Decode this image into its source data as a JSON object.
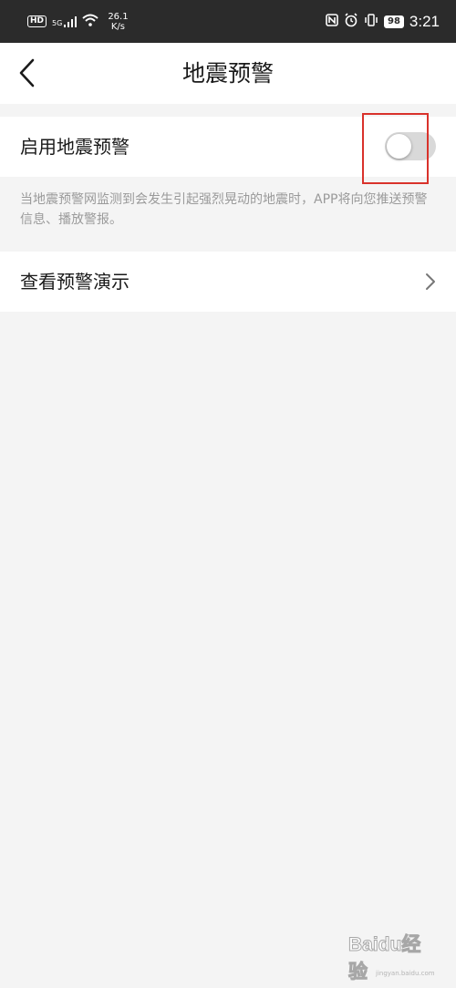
{
  "status_bar": {
    "hd": "HD",
    "network_type": "5G",
    "speed_value": "26.1",
    "speed_unit": "K/s",
    "battery": "98",
    "time": "3:21"
  },
  "header": {
    "title": "地震预警"
  },
  "earthquake_alert": {
    "label": "启用地震预警",
    "enabled": false,
    "description": "当地震预警网监测到会发生引起强烈晃动的地震时，APP将向您推送预警信息、播放警报。"
  },
  "demo_row": {
    "label": "查看预警演示"
  },
  "watermark": {
    "brand": "Baidu经验",
    "url": "jingyan.baidu.com"
  },
  "colors": {
    "status_bar_bg": "#2b2b2b",
    "page_bg": "#f4f4f4",
    "toggle_off": "#d9d9d9",
    "highlight_box": "#d9322b"
  }
}
